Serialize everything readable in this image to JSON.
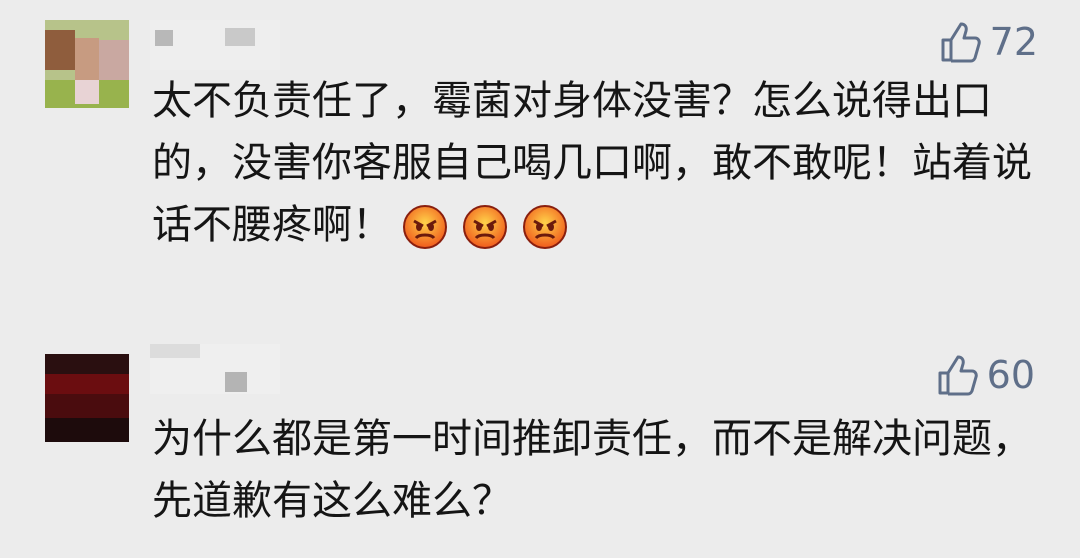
{
  "comments": [
    {
      "likes": "72",
      "text": "太不负责任了，霉菌对身体没害？怎么说得出口的，没害你客服自己喝几口啊，敢不敢呢！站着说话不腰疼啊！",
      "emojis": [
        "angry-face-icon",
        "angry-face-icon",
        "angry-face-icon"
      ]
    },
    {
      "likes": "60",
      "text": "为什么都是第一时间推卸责任，而不是解决问题，先道歉有这么难么？"
    }
  ]
}
